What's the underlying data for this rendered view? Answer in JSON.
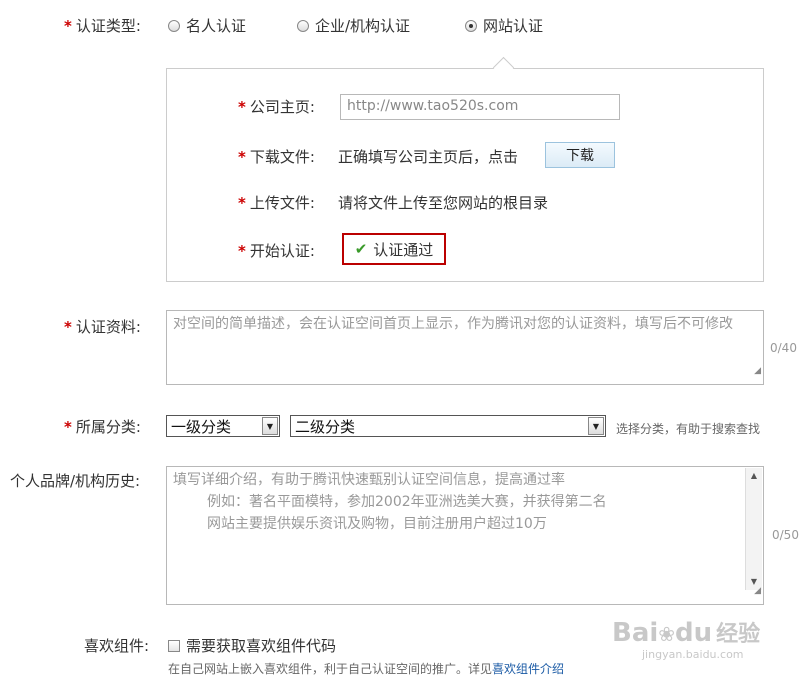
{
  "auth_type": {
    "label": "认证类型:",
    "options": [
      {
        "label": "名人认证",
        "checked": false
      },
      {
        "label": "企业/机构认证",
        "checked": false
      },
      {
        "label": "网站认证",
        "checked": true
      }
    ]
  },
  "website_panel": {
    "homepage": {
      "label": "公司主页:",
      "value": "http://www.tao520s.com"
    },
    "download": {
      "label": "下载文件:",
      "text": "正确填写公司主页后，点击",
      "button": "下载"
    },
    "upload": {
      "label": "上传文件:",
      "text": "请将文件上传至您网站的根目录"
    },
    "start": {
      "label": "开始认证:",
      "status": "认证通过",
      "status_icon": "check-icon",
      "status_color": "#3a9a2a"
    }
  },
  "auth_material": {
    "label": "认证资料:",
    "placeholder": "对空间的简单描述，会在认证空间首页上显示，作为腾讯对您的认证资料，填写后不可修改",
    "count": "0/40"
  },
  "category": {
    "label": "所属分类:",
    "level1": "一级分类",
    "level2": "二级分类",
    "hint": "选择分类，有助于搜索查找"
  },
  "history": {
    "label": "个人品牌/机构历史:",
    "lines": [
      "填写详细介绍，有助于腾讯快速甄别认证空间信息，提高通过率",
      "例如：著名平面模特，参加2002年亚洲选美大赛，并获得第二名",
      "网站主要提供娱乐资讯及购物，目前注册用户超过10万"
    ],
    "count": "0/50"
  },
  "widget": {
    "label": "喜欢组件:",
    "checkbox_label": "需要获取喜欢组件代码",
    "desc": "在自己网站上嵌入喜欢组件，利于自己认证空间的推广。详见",
    "link": "喜欢组件介绍"
  },
  "watermark": {
    "brand": "Bai",
    "brand2": "du",
    "cn": "经验",
    "url": "jingyan.baidu.com"
  },
  "colors": {
    "required": "#cc0000",
    "highlight_border": "#bb0000",
    "link": "#1a5aa5"
  }
}
